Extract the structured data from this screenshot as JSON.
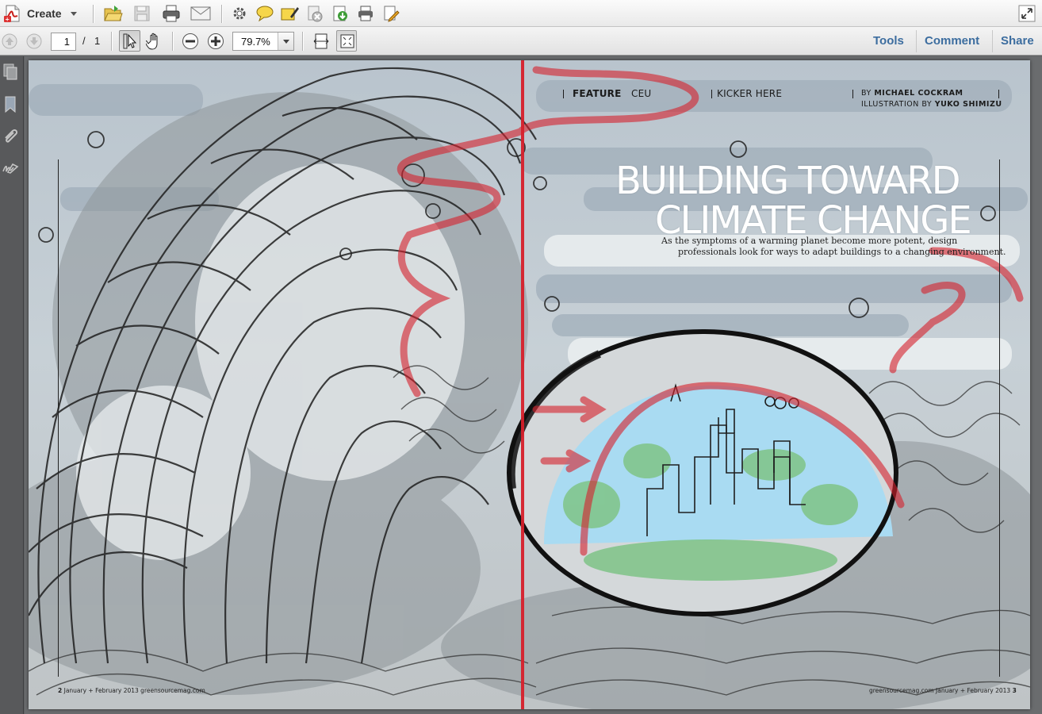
{
  "toolbar": {
    "create_label": "Create",
    "icons": [
      "create-pdf-icon",
      "open-folder-icon",
      "save-icon",
      "print-icon",
      "email-icon",
      "gear-icon",
      "comment-icon",
      "highlight-icon",
      "attach-icon",
      "export-icon",
      "print-alt-icon",
      "edit-pdf-icon",
      "expand-icon"
    ]
  },
  "nav": {
    "current_page": "1",
    "page_separator": "/",
    "total_pages": "1",
    "zoom": "79.7%"
  },
  "panes": {
    "tools": "Tools",
    "comment": "Comment",
    "share": "Share"
  },
  "document": {
    "section": "FEATURE",
    "ceu": "CEU",
    "kicker": "KICKER HERE",
    "byline_prefix": "BY",
    "author": "MICHAEL COCKRAM",
    "illustration_prefix": "ILLUSTRATION BY",
    "illustrator": "YUKO SHIMIZU",
    "headline_line1": "BUILDING TOWARD",
    "headline_line2": "CLIMATE CHANGE",
    "deck_line1": "As the symptoms of a warming planet become more potent, design",
    "deck_line2": "professionals look for ways to adapt buildings to a changing environment.",
    "folio_left_num": "2",
    "folio_left_text": "January + February 2013  greensourcemag.com",
    "folio_right_text": "greensourcemag.com  January + February 2013",
    "folio_right_num": "3"
  }
}
